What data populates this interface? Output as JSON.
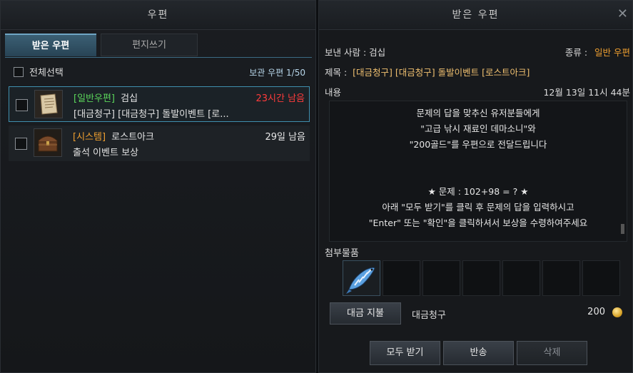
{
  "left": {
    "title": "우편",
    "tabs": [
      "받은 우편",
      "편지쓰기"
    ],
    "select_all": "전체선택",
    "storage": "보관 우편 1/50",
    "mails": [
      {
        "tag": "[일반우편]",
        "sender": "검십",
        "title": "[대금청구] [대금청구] 돌발이벤트 [로...",
        "time": "23시간 남음",
        "tag_color": "#5bd65b",
        "time_color": "#ff3b3b",
        "icon": "scroll-icon"
      },
      {
        "tag": "[시스템]",
        "sender": "로스트아크",
        "title": "출석 이벤트 보상",
        "time": "29일 남음",
        "tag_color": "#f0a030",
        "time_color": "#e6e6e6",
        "icon": "treasure-chest-icon"
      }
    ]
  },
  "right": {
    "title": "받은 우편",
    "sender_label": "보낸 사람 :",
    "sender": "검십",
    "type_label": "종류 :",
    "type_value": "일반 우편",
    "subject_label": "제목 :",
    "subject": "[대금청구] [대금청구] 돌발이벤트 [로스트아크]",
    "content_label": "내용",
    "date": "12월 13일 11시 44분",
    "body_lines": [
      "문제의 답을 맞추신 유저분들에게",
      "\"고급 낚시 재료인 데마소니\"와",
      "\"200골드\"를 우편으로 전달드립니다",
      "",
      "",
      "★ 문제 : 102+98 = ? ★",
      "아래 \"모두 받기\"를 클릭 후 문제의 답을 입력하시고",
      "\"Enter\" 또는 \"확인\"을 클릭하셔서 보상을 수령하여주세요"
    ],
    "attachments_label": "첨부물품",
    "pay_button": "대금 지불",
    "charge_label": "대금청구",
    "charge_amount": "200",
    "buttons": [
      "모두 받기",
      "반송",
      "삭제"
    ],
    "colors": {
      "accent": "#f0a030",
      "subject": "#f0c070"
    }
  }
}
